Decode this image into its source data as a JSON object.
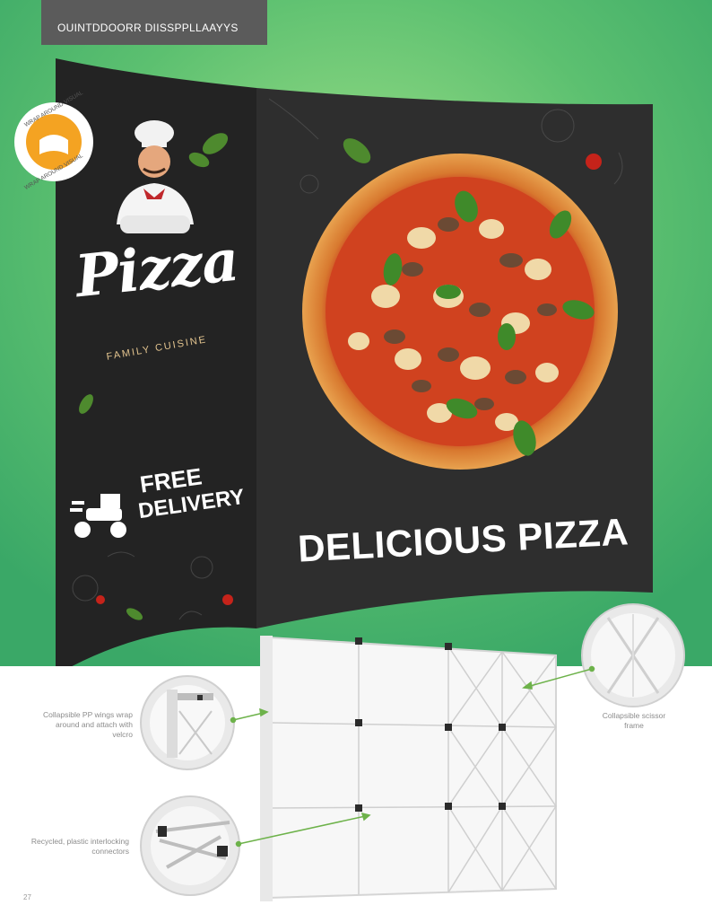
{
  "header": {
    "title": "OUINTDDOORR DIISSPPLLAAYYS"
  },
  "badge": {
    "text_top": "WRAP AROUND VISUAL",
    "text_bottom": "WRAP AROUND VISUAL"
  },
  "banner": {
    "logo_word": "Pizza",
    "logo_tagline": "FAMILY CUISINE",
    "delivery_line1": "FREE",
    "delivery_line2": "DELIVERY",
    "headline": "DELICIOUS PIZZA"
  },
  "callouts": [
    {
      "text": "Collapsible PP wings wrap around and attach with velcro"
    },
    {
      "text": "Collapsible scissor frame"
    },
    {
      "text": "Recycled, plastic interlocking connectors"
    }
  ],
  "page_number": "27",
  "colors": {
    "green": "#4fb56a",
    "board": "#2a2a2a",
    "badge_orange": "#f4a322",
    "arrow_green": "#6db24a"
  }
}
